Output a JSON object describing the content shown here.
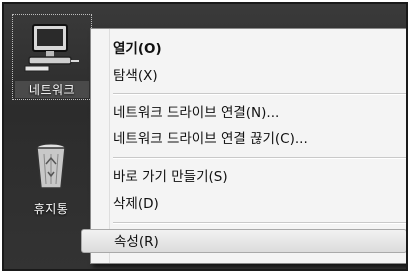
{
  "desktop": {
    "icons": [
      {
        "label": "네트워크",
        "icon": "network-computer-icon"
      },
      {
        "label": "휴지통",
        "icon": "recycle-bin-icon"
      }
    ]
  },
  "context_menu": {
    "items": [
      {
        "label": "열기(O)",
        "bold": true
      },
      {
        "label": "탐색(X)"
      },
      {
        "label": "네트워크 드라이브 연결(N)..."
      },
      {
        "label": "네트워크 드라이브 연결 끊기(C)..."
      },
      {
        "label": "바로 가기 만들기(S)"
      },
      {
        "label": "삭제(D)"
      },
      {
        "label": "속성(R)",
        "highlighted": true
      }
    ]
  }
}
